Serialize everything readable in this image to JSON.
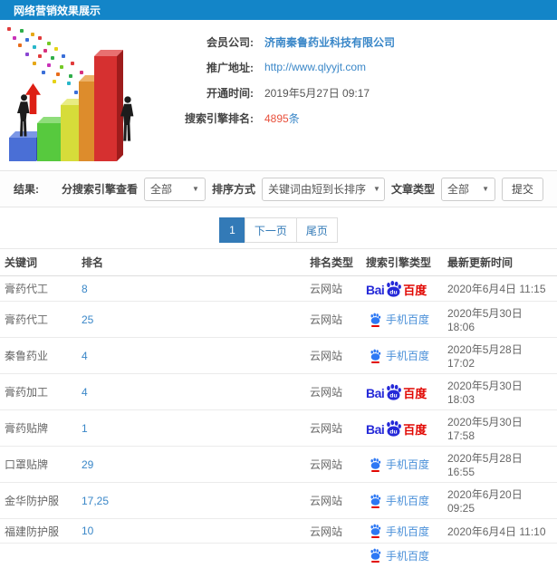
{
  "header": {
    "title": "网络营销效果展示"
  },
  "info": {
    "company_label": "会员公司:",
    "company_value": "济南秦鲁药业科技有限公司",
    "url_label": "推广地址:",
    "url_value": "http://www.qlyyjt.com",
    "open_time_label": "开通时间:",
    "open_time_value": "2019年5月27日 09:17",
    "rank_count_label": "搜索引擎排名:",
    "rank_count_value": "4895",
    "rank_count_unit": "条"
  },
  "filters": {
    "result_label": "结果:",
    "engine_label": "分搜索引擎查看",
    "engine_value": "全部",
    "sort_label": "排序方式",
    "sort_value": "关键词由短到长排序",
    "article_label": "文章类型",
    "article_value": "全部",
    "submit_label": "提交",
    "caret": "▼"
  },
  "pagination": {
    "current": "1",
    "next": "下一页",
    "last": "尾页"
  },
  "table": {
    "headers": [
      "关键词",
      "排名",
      "排名类型",
      "搜索引擎类型",
      "最新更新时间"
    ],
    "engine_labels": {
      "pc_bai": "Bai",
      "pc_du": "du",
      "pc_cn": "百度",
      "mobile": "手机百度"
    },
    "rows": [
      {
        "keyword": "膏药代工",
        "rank": "8",
        "rank_type": "云网站",
        "engine": "baidu-pc",
        "updated": "2020年6月4日 11:15"
      },
      {
        "keyword": "膏药代工",
        "rank": "25",
        "rank_type": "云网站",
        "engine": "baidu-mobile",
        "updated": "2020年5月30日 18:06"
      },
      {
        "keyword": "秦鲁药业",
        "rank": "4",
        "rank_type": "云网站",
        "engine": "baidu-mobile",
        "updated": "2020年5月28日 17:02"
      },
      {
        "keyword": "膏药加工",
        "rank": "4",
        "rank_type": "云网站",
        "engine": "baidu-pc",
        "updated": "2020年5月30日 18:03"
      },
      {
        "keyword": "膏药贴牌",
        "rank": "1",
        "rank_type": "云网站",
        "engine": "baidu-pc",
        "updated": "2020年5月30日 17:58"
      },
      {
        "keyword": "口罩贴牌",
        "rank": "29",
        "rank_type": "云网站",
        "engine": "baidu-mobile",
        "updated": "2020年5月28日 16:55"
      },
      {
        "keyword": "金华防护服",
        "rank": "17,25",
        "rank_type": "云网站",
        "engine": "baidu-mobile",
        "updated": "2020年6月20日 09:25"
      },
      {
        "keyword": "福建防护服",
        "rank": "10",
        "rank_type": "云网站",
        "engine": "baidu-mobile",
        "updated": "2020年6月4日 11:10"
      }
    ]
  },
  "colors": {
    "header_bg": "#1385c8",
    "link": "#3a87c8",
    "highlight": "#e8503c",
    "pagination_active": "#337ab7",
    "baidu_red": "#e10601",
    "baidu_blue": "#2529d8"
  }
}
